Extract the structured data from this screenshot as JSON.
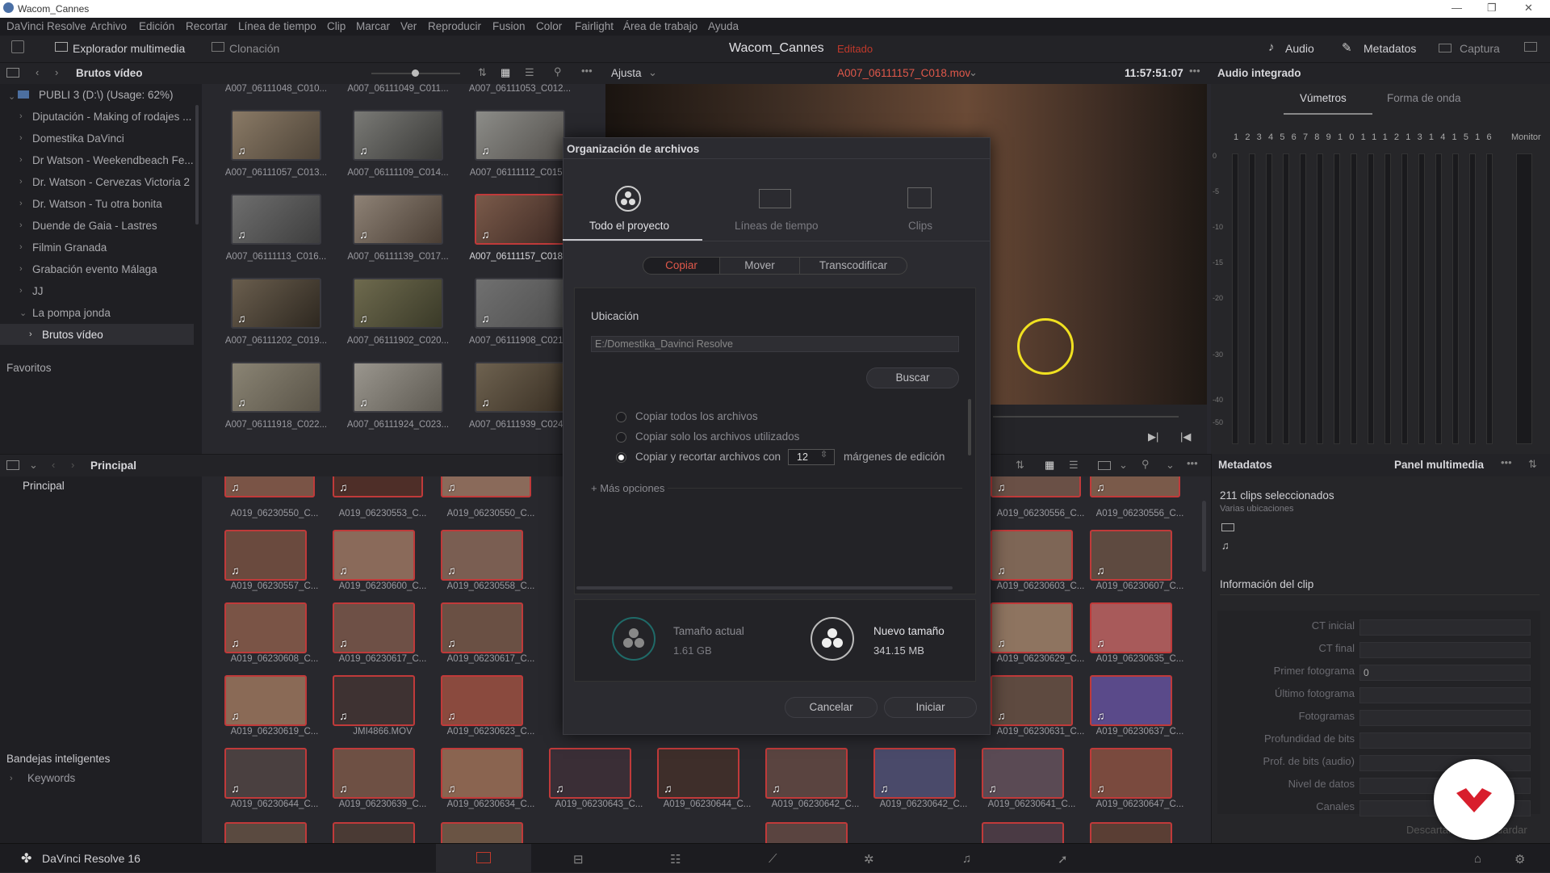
{
  "window": {
    "title": "Wacom_Cannes",
    "min": "—",
    "max": "❐",
    "close": "✕"
  },
  "menu": [
    "DaVinci Resolve",
    "Archivo",
    "Edición",
    "Recortar",
    "Línea de tiempo",
    "Clip",
    "Marcar",
    "Ver",
    "Reproducir",
    "Fusion",
    "Color",
    "Fairlight",
    "Área de trabajo",
    "Ayuda"
  ],
  "toolbar": {
    "media_pool": "Explorador multimedia",
    "clone": "Clonación",
    "project": "Wacom_Cannes",
    "status": "Editado",
    "audio": "Audio",
    "metadata": "Metadatos",
    "capture": "Captura"
  },
  "browser": {
    "bin": "Brutos vídeo",
    "volume": "PUBLI 3 (D:\\) (Usage: 62%)",
    "folders": [
      "Diputación - Making of rodajes ...",
      "Domestika DaVinci",
      "Dr Watson - Weekendbeach Fe...",
      "Dr. Watson - Cervezas Victoria 2",
      "Dr. Watson - Tu otra bonita",
      "Duende de Gaia - Lastres",
      "Filmin Granada",
      "Grabación evento Málaga",
      "JJ",
      "La pompa jonda"
    ],
    "subfolder": "Brutos vídeo",
    "favorites": "Favoritos"
  },
  "top_thumbs": {
    "row0": [
      "A007_06111048_C010...",
      "A007_06111049_C011...",
      "A007_06111053_C012..."
    ],
    "row1": [
      "A007_06111057_C013...",
      "A007_06111109_C014...",
      "A007_06111112_C015..."
    ],
    "row2": [
      "A007_06111113_C016...",
      "A007_06111139_C017...",
      "A007_06111157_C018..."
    ],
    "row3": [
      "A007_06111202_C019...",
      "A007_06111902_C020...",
      "A007_06111908_C021..."
    ],
    "row4": [
      "A007_06111918_C022...",
      "A007_06111924_C023...",
      "A007_06111939_C024..."
    ]
  },
  "viewer": {
    "mode": "Ajusta",
    "clip": "A007_06111157_C018.mov",
    "timecode": "11:57:51:07"
  },
  "pool": {
    "title": "Principal",
    "bin": "Principal",
    "smart_bins": "Bandejas inteligentes",
    "keywords": "Keywords",
    "row1": [
      "A019_06230550_C...",
      "A019_06230553_C...",
      "A019_06230550_C..."
    ],
    "row1r": [
      "A019_06230556_C...",
      "A019_06230556_C..."
    ],
    "row2": [
      "A019_06230557_C...",
      "A019_06230600_C...",
      "A019_06230558_C..."
    ],
    "row2r": [
      "A019_06230603_C...",
      "A019_06230607_C..."
    ],
    "row3": [
      "A019_06230608_C...",
      "A019_06230617_C...",
      "A019_06230617_C..."
    ],
    "row3r": [
      "A019_06230629_C...",
      "A019_06230635_C..."
    ],
    "row4": [
      "A019_06230619_C...",
      "JMI4866.MOV",
      "A019_06230623_C..."
    ],
    "row4r": [
      "A019_06230631_C...",
      "A019_06230637_C..."
    ],
    "row5": [
      "A019_06230644_C...",
      "A019_06230639_C...",
      "A019_06230634_C...",
      "A019_06230643_C...",
      "A019_06230644_C...",
      "A019_06230642_C...",
      "A019_06230642_C...",
      "A019_06230641_C...",
      "A019_06230647_C..."
    ]
  },
  "audio": {
    "title": "Audio integrado",
    "tab_meters": "Vúmetros",
    "tab_wave": "Forma de onda",
    "channels": [
      "1",
      "2",
      "3",
      "4",
      "5",
      "6",
      "7",
      "8",
      "9",
      "10",
      "11",
      "12",
      "13",
      "14",
      "15",
      "16"
    ],
    "monitor": "Monitor",
    "scale": [
      "0",
      "-5",
      "-10",
      "-15",
      "-20",
      "-30",
      "-40",
      "-50"
    ]
  },
  "metadata": {
    "title": "Metadatos",
    "panel": "Panel multimedia",
    "selected": "211 clips seleccionados",
    "locations": "Varias ubicaciones",
    "clip_info": "Información del clip",
    "fields": [
      {
        "label": "CT inicial",
        "value": ""
      },
      {
        "label": "CT final",
        "value": ""
      },
      {
        "label": "Primer fotograma",
        "value": "0"
      },
      {
        "label": "Último fotograma",
        "value": ""
      },
      {
        "label": "Fotogramas",
        "value": ""
      },
      {
        "label": "Profundidad de bits",
        "value": ""
      },
      {
        "label": "Prof. de bits (audio)",
        "value": ""
      },
      {
        "label": "Nivel de datos",
        "value": ""
      },
      {
        "label": "Canales",
        "value": ""
      }
    ],
    "discard": "Descartar",
    "save": "Guardar"
  },
  "dialog": {
    "title": "Organización de archivos",
    "tab_project": "Todo el proyecto",
    "tab_timelines": "Líneas de tiempo",
    "tab_clips": "Clips",
    "seg_copy": "Copiar",
    "seg_move": "Mover",
    "seg_transcode": "Transcodificar",
    "location_label": "Ubicación",
    "location_value": "E:/Domestika_Davinci Resolve",
    "browse": "Buscar",
    "opt1": "Copiar todos los archivos",
    "opt2": "Copiar solo los archivos utilizados",
    "opt3": "Copiar y recortar archivos con",
    "margin_value": "12",
    "margin_suffix": "márgenes de edición",
    "more_options": "+ Más opciones",
    "current_size_label": "Tamaño actual",
    "current_size": "1.61 GB",
    "new_size_label": "Nuevo tamaño",
    "new_size": "341.15 MB",
    "cancel": "Cancelar",
    "start": "Iniciar"
  },
  "footer": {
    "app": "DaVinci Resolve 16"
  }
}
